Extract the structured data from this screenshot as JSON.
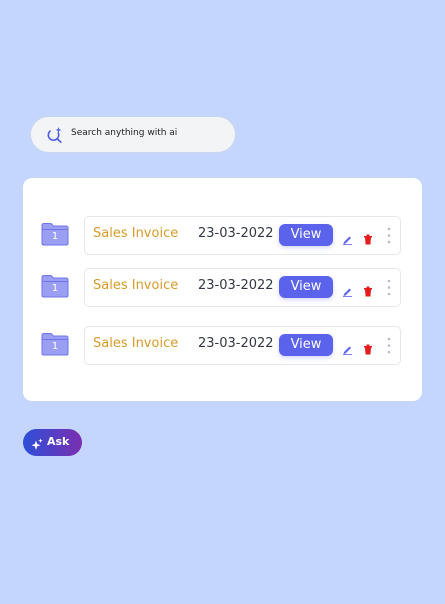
{
  "search": {
    "placeholder": "Search anything with ai"
  },
  "documents": [
    {
      "folder_number": "1",
      "name": "Sales Invoice",
      "date": "23-03-2022",
      "view_label": "View"
    },
    {
      "folder_number": "1",
      "name": "Sales Invoice",
      "date": "23-03-2022",
      "view_label": "View"
    },
    {
      "folder_number": "1",
      "name": "Sales Invoice",
      "date": "23-03-2022",
      "view_label": "View"
    }
  ],
  "ask": {
    "label": "Ask"
  },
  "icons": {
    "search": "ai-search-icon",
    "folder": "folder-icon",
    "edit": "pencil-icon",
    "delete": "trash-icon",
    "more": "more-vertical-icon",
    "ask": "sparkle-icon"
  },
  "colors": {
    "background": "#c4d6fd",
    "panel": "#ffffff",
    "accent": "#5b63ed",
    "doc_name": "#d99a28",
    "folder": "#9b9ff3",
    "delete": "#e51c1c",
    "ask_gradient_start": "#2d4fd8",
    "ask_gradient_end": "#7b2fb0"
  }
}
